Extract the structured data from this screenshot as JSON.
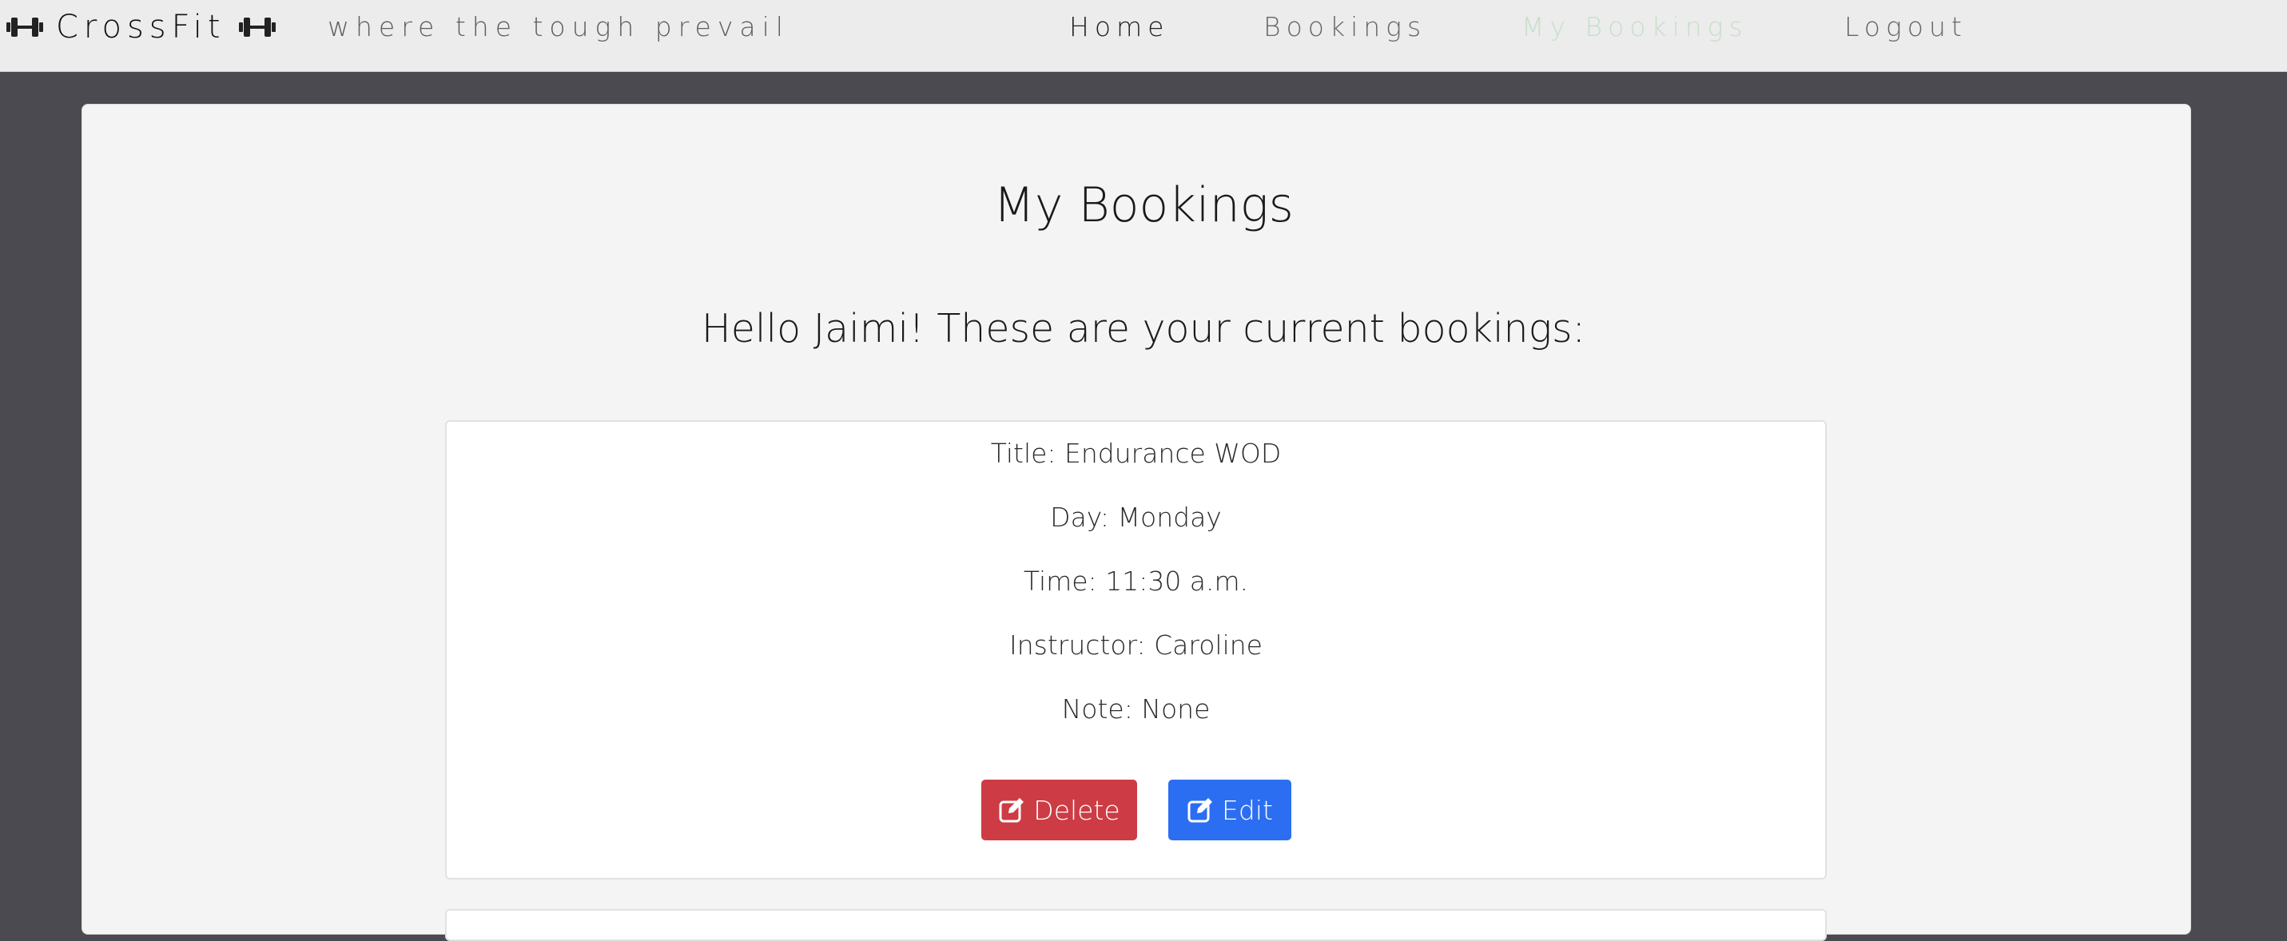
{
  "brand": {
    "name": "CrossFit",
    "tagline": "where the tough prevail",
    "icon": "dumbbell-icon"
  },
  "nav": {
    "items": [
      {
        "label": "Home",
        "active": false
      },
      {
        "label": "Bookings",
        "active": false
      },
      {
        "label": "My Bookings",
        "active": true
      },
      {
        "label": "Logout",
        "active": false
      }
    ]
  },
  "page": {
    "title": "My Bookings",
    "greeting": "Hello Jaimi! These are your current bookings:"
  },
  "bookings": [
    {
      "title": "Title: Endurance WOD",
      "day": "Day: Monday",
      "time": "Time: 11:30 a.m.",
      "instructor": "Instructor: Caroline",
      "note": "Note: None",
      "delete_label": "Delete",
      "edit_label": "Edit"
    }
  ],
  "colors": {
    "navbar_bg": "#ececec",
    "page_bg": "#4b4a50",
    "card_bg": "#f4f4f4",
    "active_nav": "#c7dfc9",
    "delete": "#cd3c44",
    "edit": "#2c6ef2"
  }
}
